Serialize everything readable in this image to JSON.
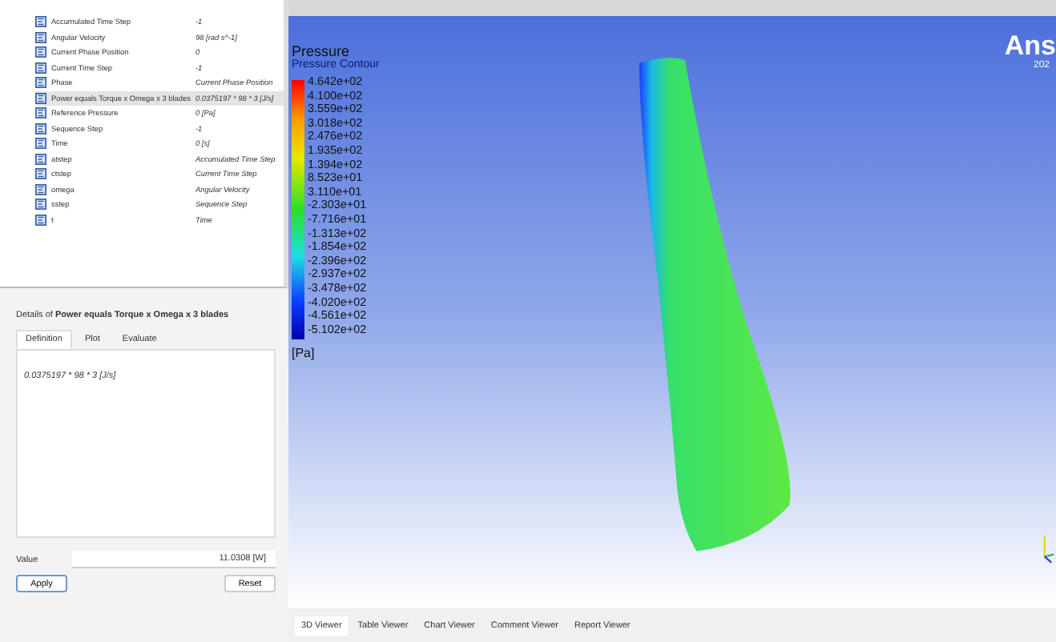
{
  "expressions": [
    {
      "name": "Accumulated Time Step",
      "value": "-1",
      "selected": false
    },
    {
      "name": "Angular Velocity",
      "value": "98 [rad s^-1]",
      "selected": false
    },
    {
      "name": "Current Phase Position",
      "value": "0",
      "selected": false
    },
    {
      "name": "Current Time Step",
      "value": "-1",
      "selected": false
    },
    {
      "name": "Phase",
      "value": "Current Phase Position",
      "selected": false
    },
    {
      "name": "Power equals Torque x Omega x 3 blades",
      "value": "0.0375197 * 98 * 3 [J/s]",
      "selected": true
    },
    {
      "name": "Reference Pressure",
      "value": "0 [Pa]",
      "selected": false
    },
    {
      "name": "Sequence Step",
      "value": "-1",
      "selected": false
    },
    {
      "name": "Time",
      "value": "0 [s]",
      "selected": false
    },
    {
      "name": "atstep",
      "value": "Accumulated Time Step",
      "selected": false
    },
    {
      "name": "ctstep",
      "value": "Current Time Step",
      "selected": false
    },
    {
      "name": "omega",
      "value": "Angular Velocity",
      "selected": false
    },
    {
      "name": "sstep",
      "value": "Sequence Step",
      "selected": false
    },
    {
      "name": "t",
      "value": "Time",
      "selected": false
    }
  ],
  "details": {
    "prefix": "Details of ",
    "subject": "Power equals Torque x Omega x 3 blades",
    "tabs": [
      {
        "label": "Definition",
        "selected": true
      },
      {
        "label": "Plot",
        "selected": false
      },
      {
        "label": "Evaluate",
        "selected": false
      }
    ],
    "definition": "0.0375197 * 98 * 3 [J/s]",
    "value_label": "Value",
    "value": "11.0308 [W]",
    "buttons": [
      "Apply",
      "Reset"
    ]
  },
  "legend": {
    "title": "Pressure",
    "subtitle": "Pressure Contour",
    "labels": [
      "4.642e+02",
      "4.100e+02",
      "3.559e+02",
      "3.018e+02",
      "2.476e+02",
      "1.935e+02",
      "1.394e+02",
      "8.523e+01",
      "3.110e+01",
      "-2.303e+01",
      "-7.716e+01",
      "-1.313e+02",
      "-1.854e+02",
      "-2.396e+02",
      "-2.937e+02",
      "-3.478e+02",
      "-4.020e+02",
      "-4.561e+02",
      "-5.102e+02"
    ],
    "unit": "[Pa]"
  },
  "logo": {
    "name": "Ans",
    "year": "202"
  },
  "viewer_tabs": [
    {
      "label": "3D Viewer",
      "selected": true
    },
    {
      "label": "Table Viewer",
      "selected": false
    },
    {
      "label": "Chart Viewer",
      "selected": false
    },
    {
      "label": "Comment Viewer",
      "selected": false
    },
    {
      "label": "Report Viewer",
      "selected": false
    }
  ]
}
